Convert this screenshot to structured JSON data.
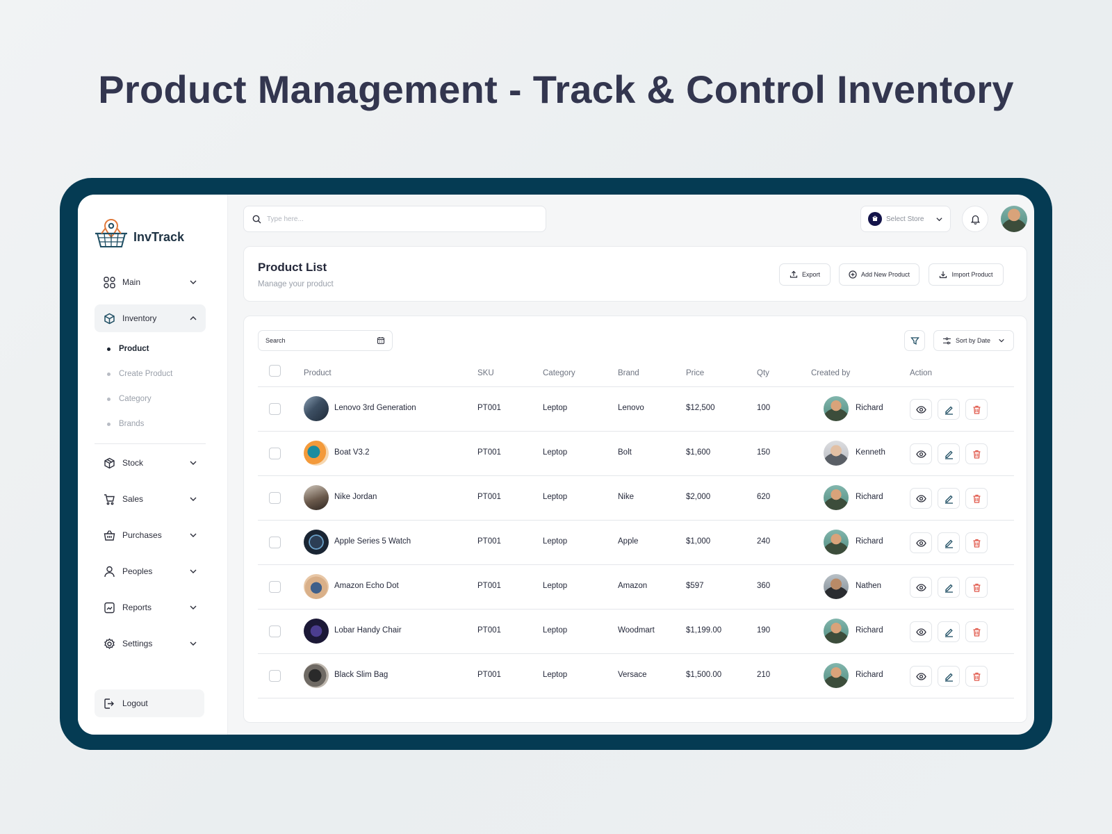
{
  "page": {
    "headline": "Product Management - Track & Control Inventory"
  },
  "sidebar": {
    "brand": "InvTrack",
    "items": [
      {
        "label": "Main",
        "icon": "grid-icon",
        "expanded": false
      },
      {
        "label": "Inventory",
        "icon": "box-icon",
        "expanded": true
      },
      {
        "label": "Stock",
        "icon": "package-icon",
        "expanded": false
      },
      {
        "label": "Sales",
        "icon": "cart-icon",
        "expanded": false
      },
      {
        "label": "Purchases",
        "icon": "basket-icon",
        "expanded": false
      },
      {
        "label": "Peoples",
        "icon": "user-icon",
        "expanded": false
      },
      {
        "label": "Reports",
        "icon": "report-icon",
        "expanded": false
      },
      {
        "label": "Settings",
        "icon": "gear-icon",
        "expanded": false
      }
    ],
    "inventory_sub": [
      "Product",
      "Create Product",
      "Category",
      "Brands"
    ],
    "active_sub": "Product",
    "logout": "Logout"
  },
  "topbar": {
    "search_placeholder": "Type here...",
    "store_label": "Select Store"
  },
  "header": {
    "title": "Product List",
    "subtitle": "Manage your product",
    "export": "Export",
    "add_new": "Add New Product",
    "import": "Import Product"
  },
  "table": {
    "search_placeholder": "Search",
    "sort_label": "Sort by Date",
    "columns": [
      "Product",
      "SKU",
      "Category",
      "Brand",
      "Price",
      "Qty",
      "Created by",
      "Action"
    ],
    "rows": [
      {
        "product": "Lenovo 3rd Generation",
        "sku": "PT001",
        "category": "Leptop",
        "brand": "Lenovo",
        "price": "$12,500",
        "qty": "100",
        "created_by": "Richard"
      },
      {
        "product": "Boat V3.2",
        "sku": "PT001",
        "category": "Leptop",
        "brand": "Bolt",
        "price": "$1,600",
        "qty": "150",
        "created_by": "Kenneth"
      },
      {
        "product": "Nike Jordan",
        "sku": "PT001",
        "category": "Leptop",
        "brand": "Nike",
        "price": "$2,000",
        "qty": "620",
        "created_by": "Richard"
      },
      {
        "product": "Apple Series 5 Watch",
        "sku": "PT001",
        "category": "Leptop",
        "brand": "Apple",
        "price": "$1,000",
        "qty": "240",
        "created_by": "Richard"
      },
      {
        "product": "Amazon Echo Dot",
        "sku": "PT001",
        "category": "Leptop",
        "brand": "Amazon",
        "price": "$597",
        "qty": "360",
        "created_by": "Nathen"
      },
      {
        "product": "Lobar Handy Chair",
        "sku": "PT001",
        "category": "Leptop",
        "brand": "Woodmart",
        "price": "$1,199.00",
        "qty": "190",
        "created_by": "Richard"
      },
      {
        "product": "Black Slim Bag",
        "sku": "PT001",
        "category": "Leptop",
        "brand": "Versace",
        "price": "$1,500.00",
        "qty": "210",
        "created_by": "Richard"
      }
    ]
  },
  "colors": {
    "frame": "#053b53",
    "headline": "#33364f",
    "delete": "#e0584a",
    "edit": "#1f4e63"
  }
}
